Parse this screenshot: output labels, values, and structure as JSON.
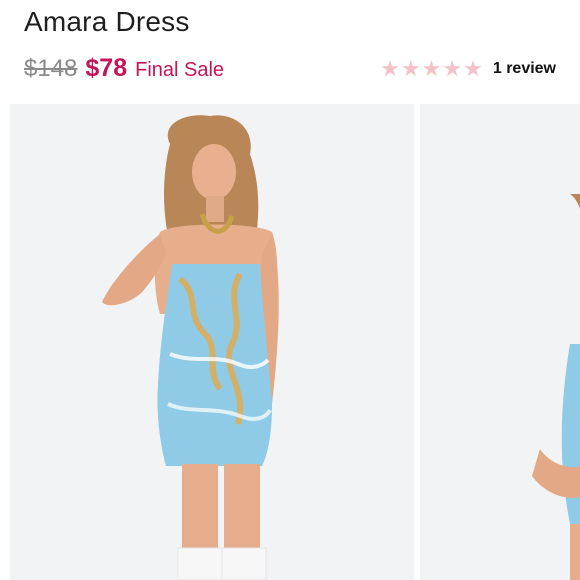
{
  "product": {
    "title": "Amara Dress",
    "original_price": "$148",
    "sale_price": "$78",
    "sale_label": "Final Sale",
    "rating": 0,
    "max_rating": 5,
    "review_count": "1 review"
  },
  "gallery": {
    "images": [
      {
        "label": "model-front"
      },
      {
        "label": "model-side-partial"
      }
    ]
  },
  "colors": {
    "sale": "#c4145a",
    "star": "#f4c3c8",
    "text": "#1f1f1f",
    "strike": "#8a8a8a"
  }
}
